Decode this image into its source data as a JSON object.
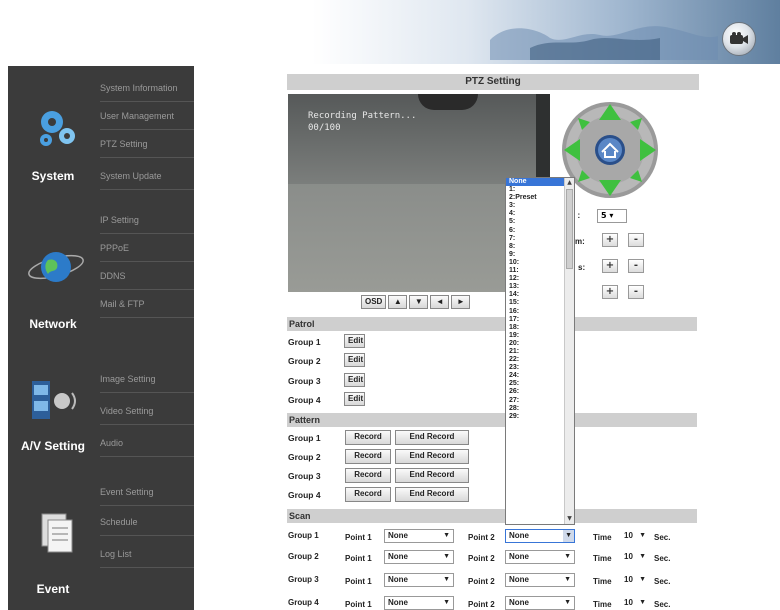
{
  "sidebar": {
    "sections": [
      {
        "label": "System",
        "items": [
          "System Information",
          "User Management",
          "PTZ Setting",
          "System Update"
        ]
      },
      {
        "label": "Network",
        "items": [
          "IP Setting",
          "PPPoE",
          "DDNS",
          "Mail & FTP"
        ]
      },
      {
        "label": "A/V Setting",
        "items": [
          "Image Setting",
          "Video Setting",
          "Audio"
        ]
      },
      {
        "label": "Event",
        "items": [
          "Event Setting",
          "Schedule",
          "Log List"
        ]
      }
    ]
  },
  "main": {
    "title": "PTZ Setting",
    "video_overlay": "Recording Pattern...\n00/100",
    "osd_button": "OSD",
    "arrows": [
      "▲",
      "▼",
      "◄",
      "►"
    ],
    "speed_label": "ed :",
    "speed_value": "5",
    "zoom_label": "m:",
    "focus_label": "s:",
    "plus": "+",
    "minus": "-"
  },
  "patrol": {
    "header": "Patrol",
    "groups": [
      "Group 1",
      "Group 2",
      "Group 3",
      "Group 4"
    ],
    "edit_label": "Edit"
  },
  "pattern": {
    "header": "Pattern",
    "groups": [
      "Group 1",
      "Group 2",
      "Group 3",
      "Group 4"
    ],
    "record_label": "Record",
    "end_label": "End Record"
  },
  "scan": {
    "header": "Scan",
    "point1_label": "Point 1",
    "point2_label": "Point 2",
    "time_label": "Time",
    "sec_label": "Sec.",
    "rows": [
      {
        "group": "Group 1",
        "p1": "None",
        "p2": "None",
        "time": "10"
      },
      {
        "group": "Group 2",
        "p1": "None",
        "p2": "None",
        "time": "10"
      },
      {
        "group": "Group 3",
        "p1": "None",
        "p2": "None",
        "time": "10"
      },
      {
        "group": "Group 4",
        "p1": "None",
        "p2": "None",
        "time": "10"
      }
    ]
  },
  "dropdown": {
    "options": [
      "None",
      "1:",
      "2:Preset",
      "3:",
      "4:",
      "5:",
      "6:",
      "7:",
      "8:",
      "9:",
      "10:",
      "11:",
      "12:",
      "13:",
      "14:",
      "15:",
      "16:",
      "17:",
      "18:",
      "19:",
      "20:",
      "21:",
      "22:",
      "23:",
      "24:",
      "25:",
      "26:",
      "27:",
      "28:",
      "29:"
    ],
    "selected": "None"
  },
  "colors": {
    "sidebar_bg": "#3b3b3b",
    "section_bar": "#cfcfcf",
    "joystick_green": "#3fc03f",
    "selected_option": "#3875d7"
  }
}
